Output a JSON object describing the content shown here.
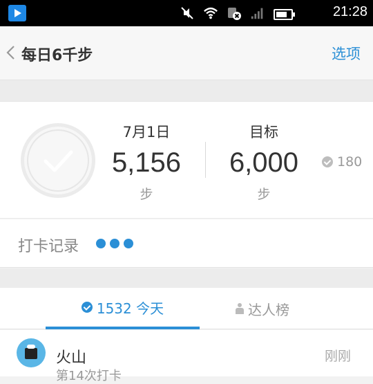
{
  "status_bar": {
    "time": "21:28"
  },
  "header": {
    "title": "每日6千步",
    "options_label": "选项"
  },
  "summary": {
    "date_label": "7月1日",
    "steps_value": "5,156",
    "steps_unit": "步",
    "goal_label": "目标",
    "goal_value": "6,000",
    "goal_unit": "步",
    "checkin_count": "180"
  },
  "record": {
    "label": "打卡记录"
  },
  "tabs": [
    {
      "label": "1532 今天",
      "active": true
    },
    {
      "label": "达人榜",
      "active": false
    }
  ],
  "list": [
    {
      "name": "火山",
      "subtitle": "第14次打卡",
      "time": "刚刚"
    }
  ],
  "colors": {
    "accent": "#2b8fd6",
    "status_bar": "#000000"
  }
}
